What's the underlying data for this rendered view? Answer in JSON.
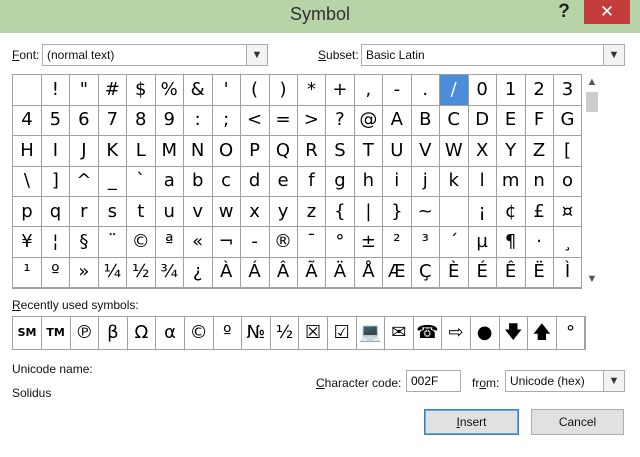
{
  "window": {
    "title": "Symbol",
    "help": "?",
    "close": "✕"
  },
  "font": {
    "label_accel": "F",
    "label_rest": "ont:",
    "value": "(normal text)"
  },
  "subset": {
    "label_accel": "S",
    "label_rest": "ubset:",
    "value": "Basic Latin"
  },
  "grid": {
    "rows": [
      [
        " ",
        "!",
        "\"",
        "#",
        "$",
        "%",
        "&",
        "'",
        "(",
        ")",
        "*",
        "+",
        ",",
        "-",
        ".",
        "/",
        "0",
        "1",
        "2",
        "3"
      ],
      [
        "4",
        "5",
        "6",
        "7",
        "8",
        "9",
        ":",
        ";",
        "<",
        "=",
        ">",
        "?",
        "@",
        "A",
        "B",
        "C",
        "D",
        "E",
        "F",
        "G"
      ],
      [
        "H",
        "I",
        "J",
        "K",
        "L",
        "M",
        "N",
        "O",
        "P",
        "Q",
        "R",
        "S",
        "T",
        "U",
        "V",
        "W",
        "X",
        "Y",
        "Z",
        "["
      ],
      [
        "\\",
        "]",
        "^",
        "_",
        "`",
        "a",
        "b",
        "c",
        "d",
        "e",
        "f",
        "g",
        "h",
        "i",
        "j",
        "k",
        "l",
        "m",
        "n",
        "o"
      ],
      [
        "p",
        "q",
        "r",
        "s",
        "t",
        "u",
        "v",
        "w",
        "x",
        "y",
        "z",
        "{",
        "|",
        "}",
        "~",
        " ",
        "¡",
        "¢",
        "£",
        "¤"
      ],
      [
        "¥",
        "¦",
        "§",
        "¨",
        "©",
        "ª",
        "«",
        "¬",
        "-",
        "®",
        "¯",
        "°",
        "±",
        "²",
        "³",
        "´",
        "µ",
        "¶",
        "·",
        "¸"
      ],
      [
        "¹",
        "º",
        "»",
        "¼",
        "½",
        "¾",
        "¿",
        "À",
        "Á",
        "Â",
        "Ã",
        "Ä",
        "Å",
        "Æ",
        "Ç",
        "È",
        "É",
        "Ê",
        "Ë",
        "Ì"
      ]
    ],
    "selected": {
      "row": 0,
      "col": 15
    },
    "scroll_up": "▲",
    "scroll_down": "▼"
  },
  "recent": {
    "label": "Recently used symbols:",
    "label_accel": "R",
    "items": [
      "SM",
      "TM",
      "℗",
      "β",
      "Ω",
      "α",
      "©",
      "º",
      "№",
      "½",
      "☒",
      "☑",
      "💻",
      "✉",
      "☎",
      "⇨",
      "●",
      "🡇",
      "🡅",
      "°"
    ]
  },
  "unicode": {
    "name_label": "Unicode name:",
    "name_value": "Solidus"
  },
  "charcode": {
    "label_accel": "C",
    "label_rest": "haracter code:",
    "value": "002F"
  },
  "from": {
    "label_pre": "fr",
    "label_accel": "o",
    "label_post": "m:",
    "value": "Unicode (hex)"
  },
  "buttons": {
    "insert": "Insert",
    "insert_accel": "I",
    "cancel": "Cancel"
  }
}
